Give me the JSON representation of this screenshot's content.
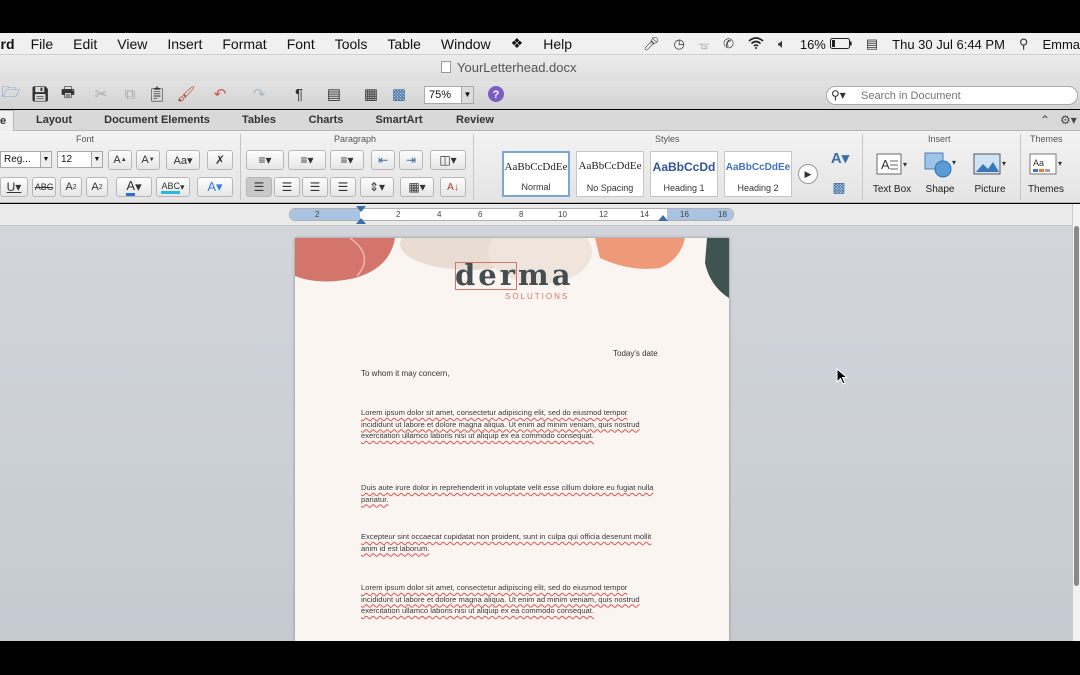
{
  "menubar": {
    "app_name": "ord",
    "items": [
      "File",
      "Edit",
      "View",
      "Insert",
      "Format",
      "Font",
      "Tools",
      "Table",
      "Window",
      "Help"
    ],
    "battery": "16%",
    "datetime": "Thu 30 Jul  6:44 PM",
    "user": "Emma"
  },
  "window": {
    "title": "YourLetterhead.docx"
  },
  "toolbar": {
    "zoom": "75%",
    "search_placeholder": "Search in Document"
  },
  "ribbon_tabs": [
    "e",
    "Layout",
    "Document Elements",
    "Tables",
    "Charts",
    "SmartArt",
    "Review"
  ],
  "ribbon": {
    "groups": {
      "font": "Font",
      "paragraph": "Paragraph",
      "styles": "Styles",
      "insert": "Insert",
      "themes": "Themes"
    },
    "font_name": "Reg...",
    "font_size": "12",
    "styles": [
      {
        "sample": "AaBbCcDdEe",
        "name": "Normal"
      },
      {
        "sample": "AaBbCcDdEe",
        "name": "No Spacing"
      },
      {
        "sample": "AaBbCcDd",
        "name": "Heading 1"
      },
      {
        "sample": "AaBbCcDdEe",
        "name": "Heading 2"
      }
    ],
    "insert": {
      "text_box": "Text Box",
      "shape": "Shape",
      "picture": "Picture",
      "themes": "Themes"
    }
  },
  "ruler": {
    "ticks": [
      "2",
      "2",
      "4",
      "6",
      "8",
      "10",
      "12",
      "14",
      "16",
      "18"
    ]
  },
  "document": {
    "logo": "derma",
    "logo_sub": "SOLUTIONS",
    "date": "Today's date",
    "salutation": "To whom it may concern,",
    "paragraphs": [
      "Lorem ipsum dolor sit amet, consectetur adipiscing elit, sed do eiusmod tempor incididunt ut labore et dolore magna aliqua. Ut enim ad minim veniam, quis nostrud exercitation ullamco laboris nisi ut aliquip ex ea commodo consequat.",
      "Duis aute irure dolor in reprehenderit in voluptate velit esse cillum dolore eu fugiat nulla pariatur.",
      "Excepteur sint occaecat cupidatat non proident, sunt in culpa qui officia deserunt mollit anim id est laborum.",
      "Lorem ipsum dolor sit amet, consectetur adipiscing elit, sed do eiusmod tempor incididunt ut labore et dolore magna aliqua. Ut enim ad minim veniam, quis nostrud exercitation ullamco laboris nisi ut aliquip ex ea commodo consequat."
    ],
    "colors": {
      "accent_coral": "#d4756c",
      "accent_orange": "#ee9a79",
      "accent_teal": "#3f5452",
      "accent_beige": "#e9ddd3"
    }
  }
}
